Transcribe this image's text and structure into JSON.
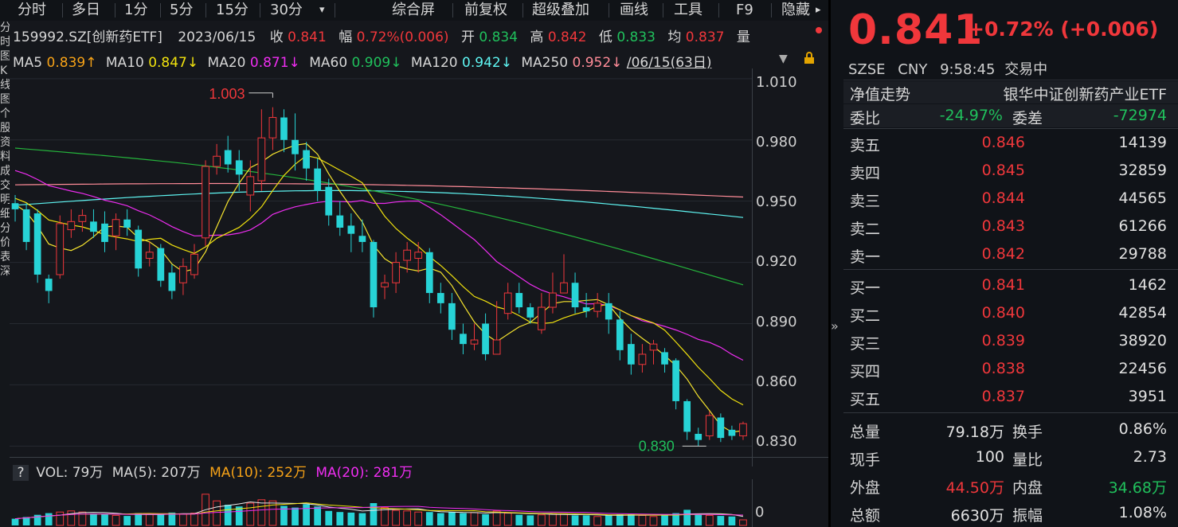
{
  "toolbar": {
    "tabs": [
      "分时",
      "多日",
      "1分",
      "5分",
      "15分",
      "30分"
    ],
    "dropdown": "▾",
    "tools": [
      "综合屏",
      "前复权",
      "超级叠加",
      "画线",
      "工具",
      "F9",
      "隐藏"
    ],
    "more": "▸"
  },
  "left_strip_chars": [
    "分",
    "时",
    "图",
    "K",
    "线",
    "图",
    "个",
    "股",
    "资",
    "料",
    "成",
    "交",
    "明",
    "细",
    "分",
    "价",
    "表",
    "深"
  ],
  "quote_line": {
    "code": "159992.SZ[创新药ETF]",
    "date": "2023/06/15",
    "close_label": "收",
    "close": "0.841",
    "range_label": "幅",
    "range": "0.72%(0.006)",
    "open_label": "开",
    "open": "0.834",
    "high_label": "高",
    "high": "0.842",
    "low_label": "低",
    "low": "0.833",
    "avg_label": "均",
    "avg": "0.837",
    "extra": "量"
  },
  "ma_line": {
    "ma5_label": "MA5",
    "ma5": "0.839↑",
    "ma10_label": "MA10",
    "ma10": "0.847↓",
    "ma20_label": "MA20",
    "ma20": "0.871↓",
    "ma60_label": "MA60",
    "ma60": "0.909↓",
    "ma120_label": "MA120",
    "ma120": "0.942↓",
    "ma250_label": "MA250",
    "ma250": "0.952↓",
    "period": "/06/15(63日)"
  },
  "annotations": {
    "high": "1.003",
    "low": "0.830"
  },
  "vol_line": {
    "help": "?",
    "vol": "VOL: 79万",
    "ma5": "MA(5): 207万",
    "ma10": "MA(10): 252万",
    "ma20": "MA(20): 281万",
    "zero": "0"
  },
  "colors": {
    "up": "#f0373b",
    "down": "#27d3d6",
    "ma5": "#f6e42e",
    "ma10": "#f1e20e",
    "ma20": "#ee2df0",
    "ma60": "#25b53c",
    "ma120": "#5ff6f3",
    "ma250": "#ff8c98"
  },
  "chart_data": {
    "type": "candlestick",
    "ylim": [
      0.82,
      1.015
    ],
    "yticks": [
      "1.010",
      "0.980",
      "0.950",
      "0.920",
      "0.890",
      "0.860",
      "0.830"
    ],
    "candles": [
      [
        0.949,
        0.946,
        0.953,
        0.94
      ],
      [
        0.946,
        0.93,
        0.949,
        0.926
      ],
      [
        0.944,
        0.914,
        0.946,
        0.91
      ],
      [
        0.912,
        0.906,
        0.914,
        0.9
      ],
      [
        0.914,
        0.939,
        0.943,
        0.912
      ],
      [
        0.936,
        0.94,
        0.946,
        0.932
      ],
      [
        0.94,
        0.943,
        0.946,
        0.935
      ],
      [
        0.94,
        0.935,
        0.946,
        0.932
      ],
      [
        0.939,
        0.93,
        0.945,
        0.925
      ],
      [
        0.933,
        0.941,
        0.944,
        0.926
      ],
      [
        0.941,
        0.937,
        0.946,
        0.933
      ],
      [
        0.936,
        0.917,
        0.938,
        0.913
      ],
      [
        0.922,
        0.925,
        0.93,
        0.918
      ],
      [
        0.927,
        0.911,
        0.929,
        0.908
      ],
      [
        0.915,
        0.906,
        0.919,
        0.902
      ],
      [
        0.91,
        0.918,
        0.922,
        0.904
      ],
      [
        0.914,
        0.924,
        0.929,
        0.912
      ],
      [
        0.932,
        0.967,
        0.97,
        0.928
      ],
      [
        0.967,
        0.972,
        0.978,
        0.963
      ],
      [
        0.975,
        0.968,
        0.982,
        0.964
      ],
      [
        0.97,
        0.963,
        0.975,
        0.955
      ],
      [
        0.953,
        0.962,
        0.97,
        0.945
      ],
      [
        0.96,
        0.981,
        0.995,
        0.955
      ],
      [
        0.981,
        0.991,
        0.996,
        0.975
      ],
      [
        0.991,
        0.98,
        0.995,
        0.974
      ],
      [
        0.98,
        0.973,
        0.993,
        0.965
      ],
      [
        0.975,
        0.966,
        0.979,
        0.96
      ],
      [
        0.966,
        0.955,
        0.971,
        0.95
      ],
      [
        0.957,
        0.943,
        0.961,
        0.938
      ],
      [
        0.943,
        0.937,
        0.95,
        0.933
      ],
      [
        0.938,
        0.934,
        0.944,
        0.925
      ],
      [
        0.933,
        0.93,
        0.941,
        0.925
      ],
      [
        0.93,
        0.898,
        0.931,
        0.893
      ],
      [
        0.908,
        0.91,
        0.914,
        0.902
      ],
      [
        0.91,
        0.92,
        0.925,
        0.905
      ],
      [
        0.921,
        0.926,
        0.93,
        0.915
      ],
      [
        0.922,
        0.925,
        0.93,
        0.915
      ],
      [
        0.925,
        0.905,
        0.927,
        0.9
      ],
      [
        0.905,
        0.9,
        0.91,
        0.895
      ],
      [
        0.9,
        0.887,
        0.905,
        0.882
      ],
      [
        0.885,
        0.88,
        0.89,
        0.875
      ],
      [
        0.88,
        0.882,
        0.89,
        0.877
      ],
      [
        0.89,
        0.875,
        0.895,
        0.872
      ],
      [
        0.875,
        0.882,
        0.901,
        0.875
      ],
      [
        0.895,
        0.905,
        0.91,
        0.892
      ],
      [
        0.905,
        0.898,
        0.91,
        0.895
      ],
      [
        0.898,
        0.893,
        0.9,
        0.89
      ],
      [
        0.887,
        0.898,
        0.905,
        0.885
      ],
      [
        0.898,
        0.905,
        0.915,
        0.895
      ],
      [
        0.905,
        0.91,
        0.924,
        0.905
      ],
      [
        0.91,
        0.898,
        0.915,
        0.895
      ],
      [
        0.898,
        0.896,
        0.905,
        0.893
      ],
      [
        0.896,
        0.9,
        0.905,
        0.893
      ],
      [
        0.9,
        0.892,
        0.905,
        0.885
      ],
      [
        0.892,
        0.877,
        0.896,
        0.872
      ],
      [
        0.88,
        0.87,
        0.885,
        0.865
      ],
      [
        0.87,
        0.875,
        0.88,
        0.866
      ],
      [
        0.877,
        0.88,
        0.882,
        0.87
      ],
      [
        0.876,
        0.87,
        0.878,
        0.866
      ],
      [
        0.872,
        0.852,
        0.873,
        0.848
      ],
      [
        0.852,
        0.837,
        0.853,
        0.833
      ],
      [
        0.836,
        0.833,
        0.839,
        0.83
      ],
      [
        0.835,
        0.845,
        0.847,
        0.833
      ],
      [
        0.844,
        0.834,
        0.846,
        0.832
      ],
      [
        0.838,
        0.835,
        0.84,
        0.833
      ],
      [
        0.835,
        0.841,
        0.842,
        0.833
      ]
    ],
    "volumes": [
      1.2,
      1.5,
      1.9,
      2.2,
      2.4,
      2.6,
      2.4,
      2.1,
      2.0,
      1.8,
      1.7,
      2.2,
      2.0,
      2.0,
      2.3,
      2.0,
      2.2,
      5.6,
      4.4,
      3.7,
      3.4,
      4.0,
      4.6,
      4.4,
      3.5,
      3.2,
      3.8,
      3.4,
      2.6,
      2.4,
      2.3,
      2.2,
      4.0,
      3.2,
      2.7,
      2.6,
      2.4,
      2.4,
      2.2,
      2.4,
      2.2,
      2.3,
      2.0,
      2.6,
      2.2,
      1.9,
      1.8,
      1.9,
      2.1,
      2.1,
      1.8,
      1.8,
      1.6,
      1.8,
      2.0,
      2.0,
      1.8,
      1.6,
      1.9,
      2.2,
      2.8,
      1.9,
      1.8,
      1.7,
      1.6,
      1.0
    ]
  },
  "right": {
    "price": "0.841",
    "change": "+0.72% (+0.006)",
    "exchange": "SZSE",
    "currency": "CNY",
    "time": "9:58:45",
    "status": "交易中",
    "nav_label": "净值走势",
    "name": "银华中证创新药产业ETF",
    "weibi_label": "委比",
    "weibi": "-24.97%",
    "weicha_label": "委差",
    "weicha": "-72974",
    "asks": [
      {
        "label": "卖五",
        "price": "0.846",
        "vol": "14139"
      },
      {
        "label": "卖四",
        "price": "0.845",
        "vol": "32859"
      },
      {
        "label": "卖三",
        "price": "0.844",
        "vol": "44565"
      },
      {
        "label": "卖二",
        "price": "0.843",
        "vol": "61266"
      },
      {
        "label": "卖一",
        "price": "0.842",
        "vol": "29788"
      }
    ],
    "bids": [
      {
        "label": "买一",
        "price": "0.841",
        "vol": "1462"
      },
      {
        "label": "买二",
        "price": "0.840",
        "vol": "42854"
      },
      {
        "label": "买三",
        "price": "0.839",
        "vol": "38920"
      },
      {
        "label": "买四",
        "price": "0.838",
        "vol": "22456"
      },
      {
        "label": "买五",
        "price": "0.837",
        "vol": "3951"
      }
    ],
    "stats": [
      {
        "l1": "总量",
        "v1": "79.18万",
        "l2": "换手",
        "v2": "0.86%"
      },
      {
        "l1": "现手",
        "v1": "100",
        "l2": "量比",
        "v2": "2.73"
      },
      {
        "l1": "外盘",
        "v1": "44.50万",
        "l2": "内盘",
        "v2": "34.68万"
      },
      {
        "l1": "总额",
        "v1": "6630万",
        "l2": "振幅",
        "v2": "1.08%"
      }
    ],
    "collapse": "»"
  }
}
